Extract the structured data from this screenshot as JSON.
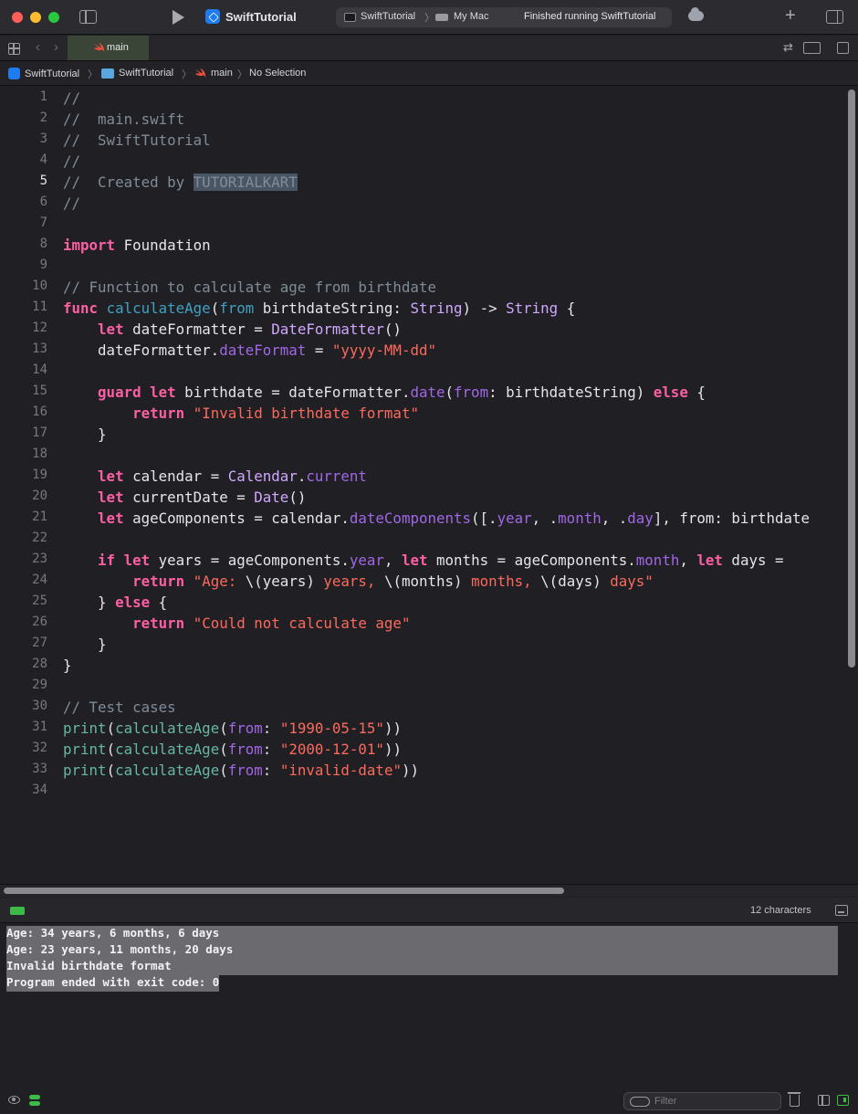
{
  "window": {
    "app_title": "SwiftTutorial",
    "scheme": "SwiftTutorial",
    "destination": "My Mac",
    "status": "Finished running SwiftTutorial"
  },
  "tabs": [
    {
      "label": "main",
      "active": true
    }
  ],
  "breadcrumb": {
    "project": "SwiftTutorial",
    "folder": "SwiftTutorial",
    "file": "main",
    "selection": "No Selection"
  },
  "editor": {
    "current_line": 5,
    "line_numbers": [
      "1",
      "2",
      "3",
      "4",
      "5",
      "6",
      "7",
      "8",
      "9",
      "10",
      "11",
      "12",
      "13",
      "14",
      "15",
      "16",
      "17",
      "18",
      "19",
      "20",
      "21",
      "22",
      "23",
      "24",
      "25",
      "26",
      "27",
      "28",
      "29",
      "30",
      "31",
      "32",
      "33",
      "34"
    ],
    "lines": [
      "//",
      "//  main.swift",
      "//  SwiftTutorial",
      "//",
      "//  Created by TUTORIALKART",
      "//",
      "",
      "import Foundation",
      "",
      "// Function to calculate age from birthdate",
      "func calculateAge(from birthdateString: String) -> String {",
      "    let dateFormatter = DateFormatter()",
      "    dateFormatter.dateFormat = \"yyyy-MM-dd\"",
      "",
      "    guard let birthdate = dateFormatter.date(from: birthdateString) else {",
      "        return \"Invalid birthdate format\"",
      "    }",
      "",
      "    let calendar = Calendar.current",
      "    let currentDate = Date()",
      "    let ageComponents = calendar.dateComponents([.year, .month, .day], from: birthdate",
      "",
      "    if let years = ageComponents.year, let months = ageComponents.month, let days =",
      "        return \"Age: \\(years) years, \\(months) months, \\(days) days\"",
      "    } else {",
      "        return \"Could not calculate age\"",
      "    }",
      "}",
      "",
      "// Test cases",
      "print(calculateAge(from: \"1990-05-15\"))",
      "print(calculateAge(from: \"2000-12-01\"))",
      "print(calculateAge(from: \"invalid-date\"))",
      ""
    ]
  },
  "console": {
    "char_count": "12 characters",
    "output": [
      "Age: 34 years, 6 months, 6 days",
      "Age: 23 years, 11 months, 20 days",
      "Invalid birthdate format",
      "Program ended with exit code: 0"
    ],
    "filter_placeholder": "Filter"
  },
  "icons": {
    "app": "xcode-app-icon",
    "run": "play-icon",
    "folder": "folder-icon",
    "swift": "swift-file-icon"
  },
  "colors": {
    "keyword": "#fc5fa3",
    "string": "#fc6a5d",
    "comment": "#7f8c98",
    "type": "#d0a8ff",
    "function_call": "#67b7a4",
    "property": "#a167e6",
    "declaration": "#41a1c0",
    "status_green": "#3dbb46"
  }
}
